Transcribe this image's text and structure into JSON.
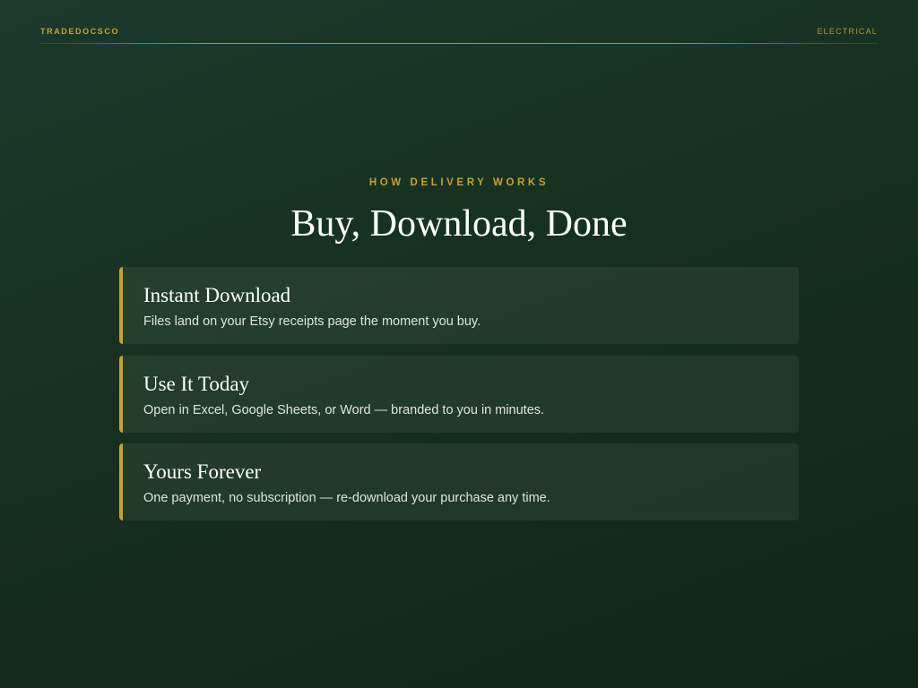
{
  "header": {
    "brand": "TRADEDOCSCO",
    "category": "ELECTRICAL"
  },
  "section": {
    "eyebrow": "HOW DELIVERY WORKS",
    "title": "Buy, Download, Done"
  },
  "cards": [
    {
      "title": "Instant Download",
      "description": "Files land on your Etsy receipts page the moment you buy."
    },
    {
      "title": "Use It Today",
      "description": "Open in Excel, Google Sheets, or Word — branded to you in minutes."
    },
    {
      "title": "Yours Forever",
      "description": "One payment, no subscription — re-download your purchase any time."
    }
  ],
  "colors": {
    "background": "#1b3a2c",
    "accent": "#c9a033",
    "heading": "#ffffff",
    "body_text": "#dfe3df"
  }
}
